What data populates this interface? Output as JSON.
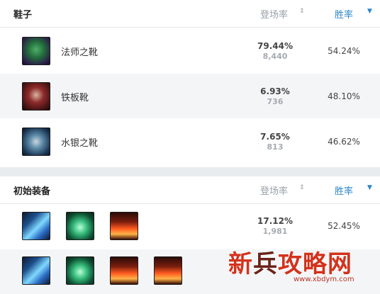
{
  "boots": {
    "title": "鞋子",
    "pick_header": "登场率",
    "win_header": "胜率",
    "sort_icon": "sort-updown-icon",
    "drop_icon": "caret-down-icon",
    "rows": [
      {
        "name": "法师之靴",
        "pick_rate": "79.44%",
        "pick_count": "8,440",
        "win_rate": "54.24%",
        "icon": "sorcerers-shoes-icon"
      },
      {
        "name": "铁板靴",
        "pick_rate": "6.93%",
        "pick_count": "736",
        "win_rate": "48.10%",
        "icon": "plated-steelcaps-icon"
      },
      {
        "name": "水银之靴",
        "pick_rate": "7.65%",
        "pick_count": "813",
        "win_rate": "46.62%",
        "icon": "mercurys-treads-icon"
      }
    ]
  },
  "starter": {
    "title": "初始装备",
    "pick_header": "登场率",
    "win_header": "胜率",
    "rows": [
      {
        "pick_rate": "17.12%",
        "pick_count": "1,981",
        "win_rate": "52.45%",
        "icons": [
          "blade-icon",
          "potion-icon",
          "trinket-icon"
        ]
      },
      {
        "icons": [
          "blade-icon",
          "potion-icon",
          "trinket-icon",
          "trinket-icon"
        ]
      }
    ]
  },
  "watermark": {
    "text_red1": "新",
    "text_dark": "兵",
    "text_red2": "攻略网",
    "url": "www.xbdym.com"
  },
  "colors": {
    "accent_blue": "#2d86c9",
    "muted_gray": "#9aa1a8",
    "watermark_red": "#d3321c"
  }
}
